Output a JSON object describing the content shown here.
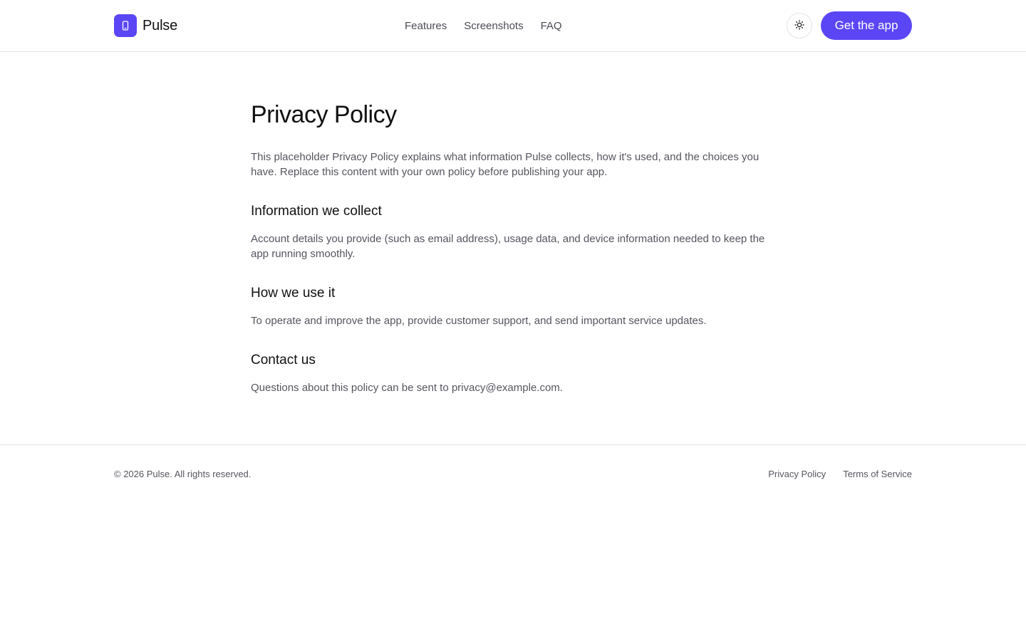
{
  "colors": {
    "accent": "#5b46f5"
  },
  "header": {
    "brand_name": "Pulse",
    "brand_icon": "phone-icon",
    "nav": [
      {
        "label": "Features"
      },
      {
        "label": "Screenshots"
      },
      {
        "label": "FAQ"
      }
    ],
    "theme_icon": "sun-icon",
    "cta_label": "Get the app"
  },
  "main": {
    "title": "Privacy Policy",
    "intro": "This placeholder Privacy Policy explains what information Pulse collects, how it's used, and the choices you have. Replace this content with your own policy before publishing your app.",
    "sections": [
      {
        "heading": "Information we collect",
        "body": "Account details you provide (such as email address), usage data, and device information needed to keep the app running smoothly."
      },
      {
        "heading": "How we use it",
        "body": "To operate and improve the app, provide customer support, and send important service updates."
      },
      {
        "heading": "Contact us",
        "body": "Questions about this policy can be sent to privacy@example.com."
      }
    ]
  },
  "footer": {
    "copyright": "© 2026 Pulse. All rights reserved.",
    "links": [
      {
        "label": "Privacy Policy"
      },
      {
        "label": "Terms of Service"
      }
    ]
  }
}
